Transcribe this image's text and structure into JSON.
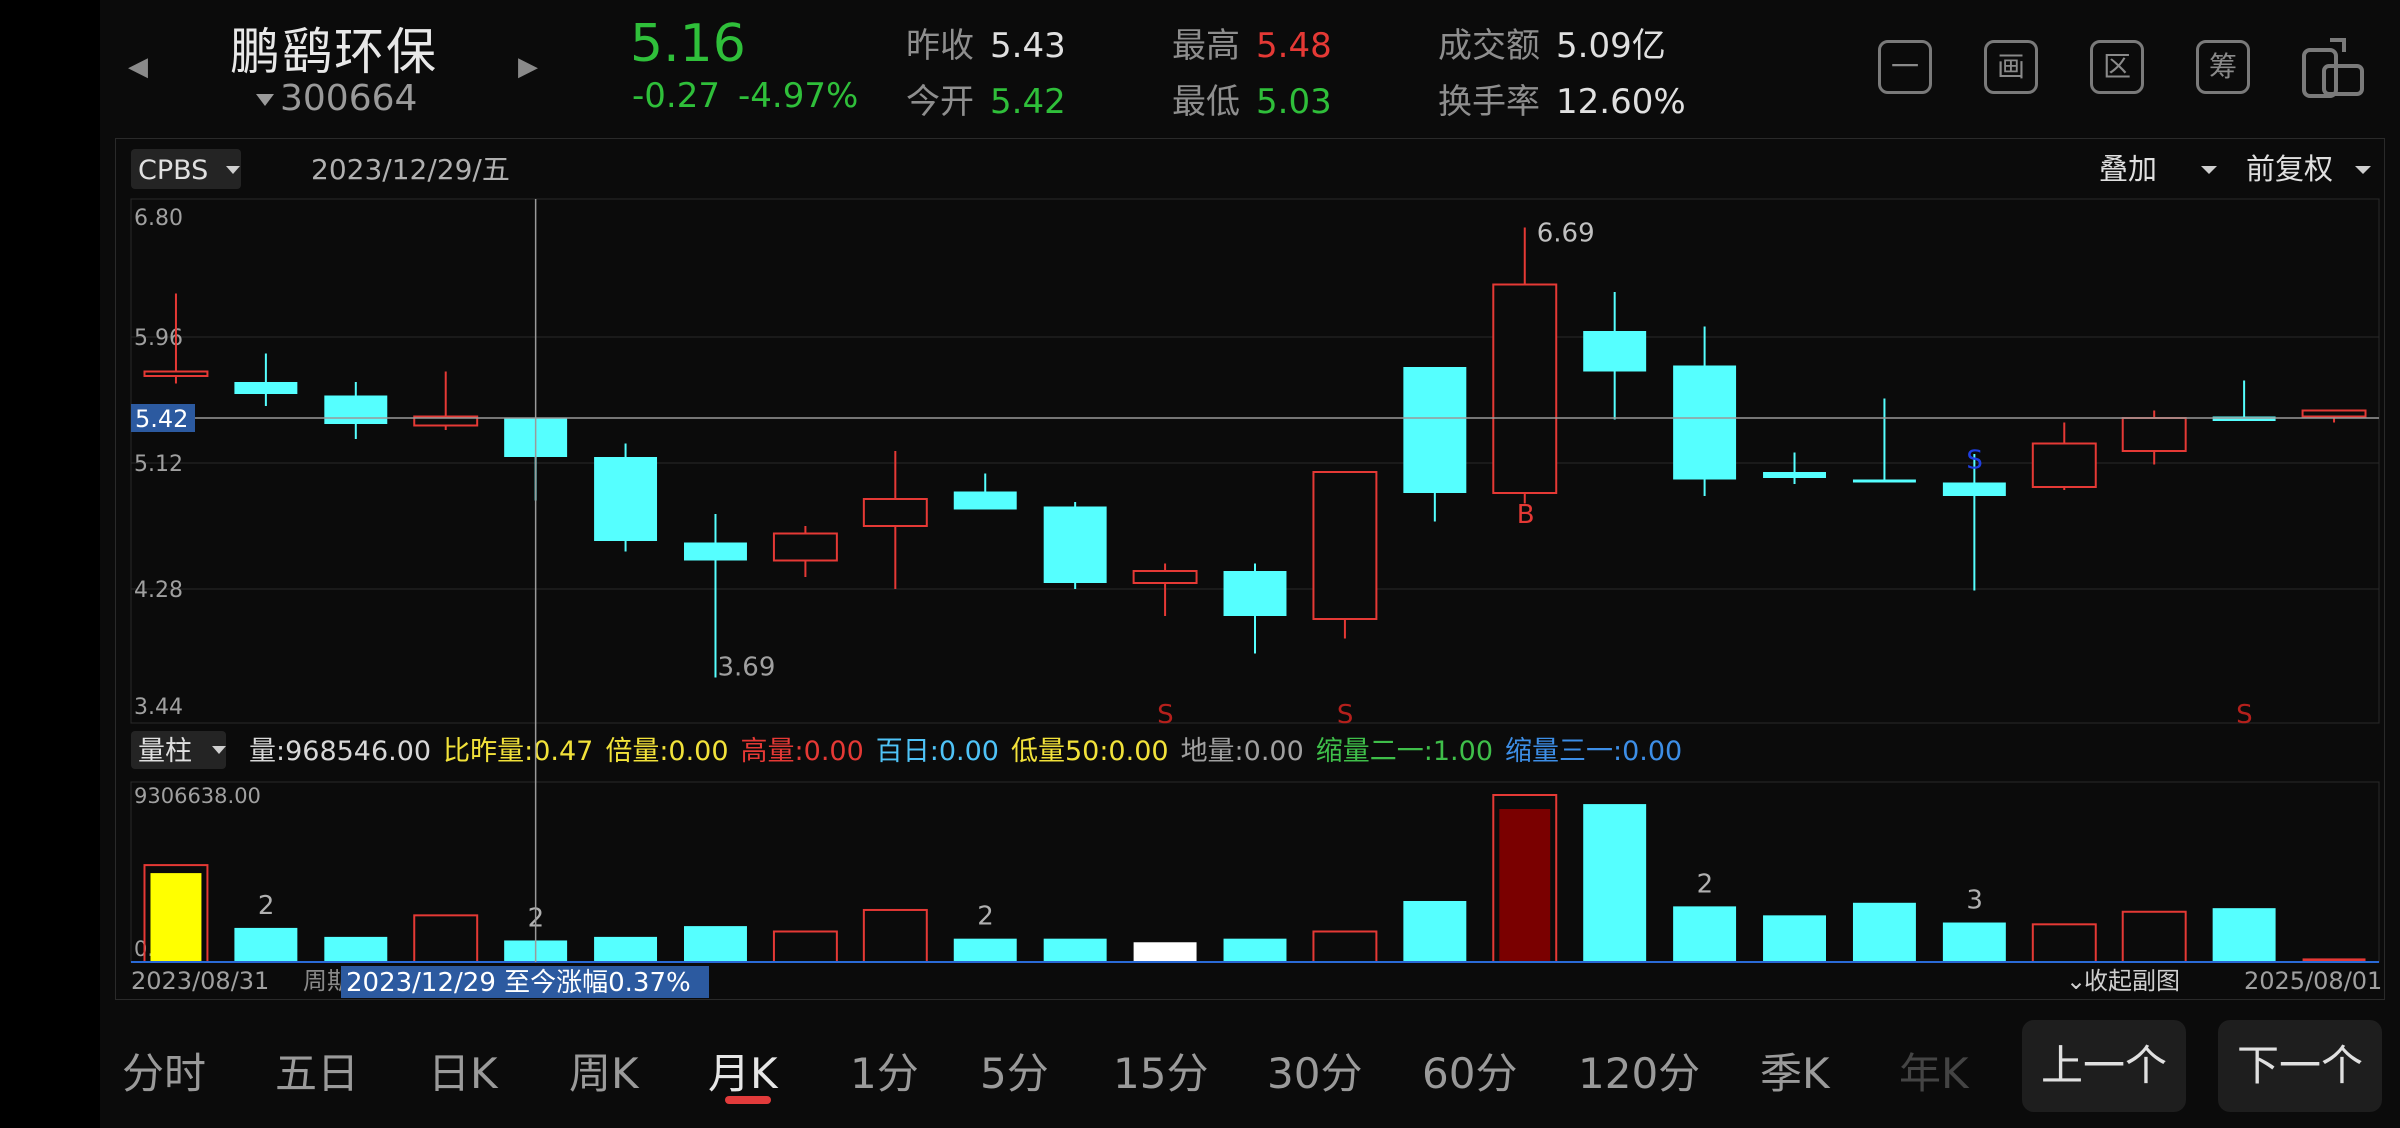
{
  "stock": {
    "name": "鹏鹞环保",
    "code": "300664",
    "price": "5.16",
    "change": "-0.27",
    "change_pct": "-4.97%"
  },
  "quote": {
    "prev_close_label": "昨收",
    "prev_close": "5.43",
    "open_label": "今开",
    "open": "5.42",
    "high_label": "最高",
    "high": "5.48",
    "low_label": "最低",
    "low": "5.03",
    "amount_label": "成交额",
    "amount": "5.09亿",
    "turnover_label": "换手率",
    "turnover": "12.60%"
  },
  "toolbar": {
    "icons": [
      "minus-icon",
      "picture-icon",
      "region-icon",
      "chips-icon",
      "switch-device-icon"
    ],
    "labels": [
      "一",
      "画",
      "区",
      "筹",
      ""
    ]
  },
  "chart_header": {
    "indicator": "CPBS",
    "date": "2023/12/29/五",
    "overlay": "叠加",
    "adjust": "前复权"
  },
  "sub_header": {
    "label": "量柱",
    "items": [
      {
        "text": "量:968546.00",
        "color": "#d8d8d8"
      },
      {
        "text": "比昨量:0.47",
        "color": "#f2e23a"
      },
      {
        "text": "倍量:0.00",
        "color": "#f2e23a"
      },
      {
        "text": "高量:0.00",
        "color": "#e53935"
      },
      {
        "text": "百日:0.00",
        "color": "#4fc3f7"
      },
      {
        "text": "低量50:0.00",
        "color": "#f2e23a"
      },
      {
        "text": "地量:0.00",
        "color": "#a0a0a0"
      },
      {
        "text": "缩量二一:1.00",
        "color": "#3fbf4a"
      },
      {
        "text": "缩量三一:0.00",
        "color": "#3d8ee6"
      }
    ]
  },
  "footer": {
    "start_date": "2023/08/31",
    "period_hint": "周期",
    "range_text": "2023/12/29 至今涨幅0.37%",
    "collapse": "收起副图",
    "end_date": "2025/08/01"
  },
  "timebar": {
    "items": [
      "分时",
      "五日",
      "日K",
      "周K",
      "月K",
      "1分",
      "5分",
      "15分",
      "30分",
      "60分",
      "120分",
      "季K",
      "年K"
    ],
    "active": "月K",
    "prev": "上一个",
    "next": "下一个"
  },
  "chart_data": [
    {
      "type": "candlestick",
      "yticks": [
        6.8,
        5.96,
        5.12,
        4.28,
        3.44
      ],
      "ylim": [
        3.44,
        6.8
      ],
      "crosshair_value": 5.42,
      "candles": [
        {
          "o": 5.7,
          "h": 6.25,
          "l": 5.65,
          "c": 5.73
        },
        {
          "o": 5.66,
          "h": 5.85,
          "l": 5.5,
          "c": 5.58
        },
        {
          "o": 5.57,
          "h": 5.66,
          "l": 5.28,
          "c": 5.38
        },
        {
          "o": 5.37,
          "h": 5.73,
          "l": 5.34,
          "c": 5.43
        },
        {
          "o": 5.42,
          "h": 5.42,
          "l": 4.87,
          "c": 5.16
        },
        {
          "o": 5.16,
          "h": 5.25,
          "l": 4.53,
          "c": 4.6
        },
        {
          "o": 4.59,
          "h": 4.78,
          "l": 3.69,
          "c": 4.47
        },
        {
          "o": 4.47,
          "h": 4.7,
          "l": 4.36,
          "c": 4.65
        },
        {
          "o": 4.7,
          "h": 5.2,
          "l": 4.28,
          "c": 4.88
        },
        {
          "o": 4.93,
          "h": 5.05,
          "l": 4.85,
          "c": 4.81
        },
        {
          "o": 4.83,
          "h": 4.86,
          "l": 4.28,
          "c": 4.32
        },
        {
          "o": 4.32,
          "h": 4.45,
          "l": 4.1,
          "c": 4.4
        },
        {
          "o": 4.4,
          "h": 4.45,
          "l": 3.85,
          "c": 4.1
        },
        {
          "o": 4.08,
          "h": 4.98,
          "l": 3.95,
          "c": 5.06
        },
        {
          "o": 5.76,
          "h": 5.76,
          "l": 4.73,
          "c": 4.92
        },
        {
          "o": 4.92,
          "h": 6.69,
          "l": 4.85,
          "c": 6.31
        },
        {
          "o": 6.0,
          "h": 6.26,
          "l": 5.41,
          "c": 5.73
        },
        {
          "o": 5.77,
          "h": 6.03,
          "l": 4.9,
          "c": 5.01
        },
        {
          "o": 5.06,
          "h": 5.19,
          "l": 4.98,
          "c": 5.02
        },
        {
          "o": 5.01,
          "h": 5.55,
          "l": 4.99,
          "c": 4.99
        },
        {
          "o": 4.99,
          "h": 5.18,
          "l": 4.27,
          "c": 4.9
        },
        {
          "o": 4.96,
          "h": 5.39,
          "l": 4.94,
          "c": 5.25
        },
        {
          "o": 5.2,
          "h": 5.47,
          "l": 5.11,
          "c": 5.42
        },
        {
          "o": 5.43,
          "h": 5.67,
          "l": 5.4,
          "c": 5.4
        },
        {
          "o": 5.43,
          "h": 5.47,
          "l": 5.39,
          "c": 5.47
        }
      ],
      "annotations": [
        {
          "idx": 6,
          "text": "3.69",
          "kind": "low"
        },
        {
          "idx": 15,
          "text": "6.69",
          "kind": "high"
        },
        {
          "idx": 15,
          "text": "B",
          "kind": "signal-b"
        },
        {
          "idx": 20,
          "text": "S",
          "kind": "signal-blue"
        },
        {
          "idx": 11,
          "text": "S",
          "kind": "bottom-s"
        },
        {
          "idx": 13,
          "text": "S",
          "kind": "bottom-s"
        },
        {
          "idx": 23,
          "text": "S",
          "kind": "bottom-s"
        }
      ]
    },
    {
      "type": "bar",
      "yticks": [
        9306638.0,
        0.0
      ],
      "ylim": [
        0,
        9306638
      ],
      "volumes": [
        5400000,
        1900000,
        1400000,
        2600000,
        1200000,
        1400000,
        2000000,
        1700000,
        2900000,
        1300000,
        1300000,
        1100000,
        1300000,
        1700000,
        3400000,
        9306638,
        8800000,
        3100000,
        2600000,
        3300000,
        2200000,
        2100000,
        2800000,
        3000000,
        200000
      ],
      "colors": [
        "yellow",
        "cyan",
        "cyan",
        "red-hollow",
        "cyan",
        "cyan",
        "cyan",
        "red-hollow",
        "red-hollow",
        "cyan",
        "cyan",
        "white",
        "cyan",
        "red-hollow",
        "cyan",
        "darkred",
        "cyan",
        "cyan",
        "cyan",
        "cyan",
        "cyan",
        "red-hollow",
        "red-hollow",
        "cyan",
        "red"
      ],
      "labels": [
        {
          "idx": 1,
          "text": "2"
        },
        {
          "idx": 4,
          "text": "2"
        },
        {
          "idx": 9,
          "text": "2"
        },
        {
          "idx": 17,
          "text": "2"
        },
        {
          "idx": 20,
          "text": "3"
        }
      ]
    }
  ]
}
